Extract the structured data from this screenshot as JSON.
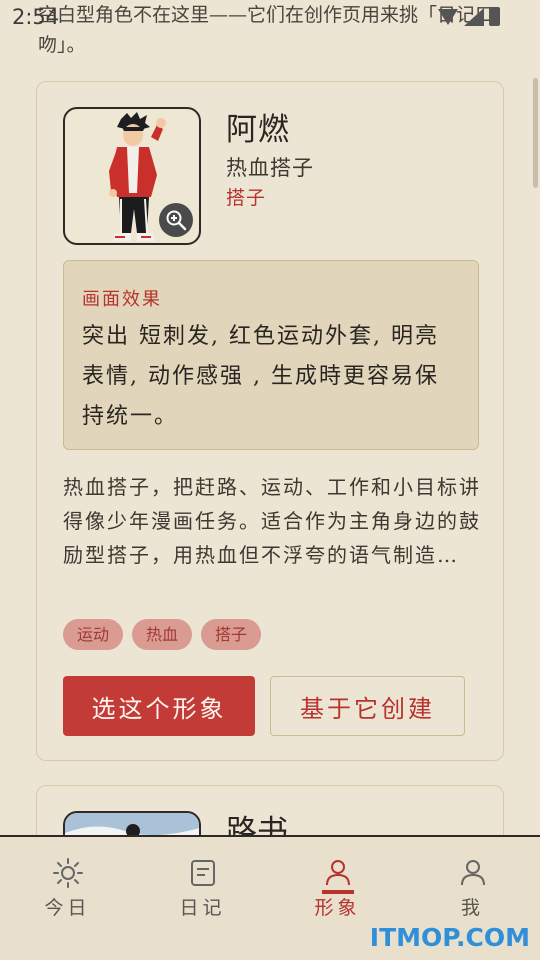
{
  "status_bar": {
    "time": "2:54"
  },
  "intro": {
    "text": "空白型角色不在这里——它们在创作页用来挑「日记口吻」。"
  },
  "cards": [
    {
      "name": "阿燃",
      "role": "热血搭子",
      "tag": "搭子",
      "effect_title": "画面效果",
      "effect_text": "突出 短刺发, 红色运动外套, 明亮表情, 动作感强 , 生成時更容易保持统一。",
      "description": "热血搭子，把赶路、运动、工作和小目标讲得像少年漫画任务。适合作为主角身边的鼓励型搭子，用热血但不浮夸的语气制造…",
      "chips": [
        "运动",
        "热血",
        "搭子"
      ],
      "primary_button": "选这个形象",
      "secondary_button": "基于它创建"
    },
    {
      "name": "路书"
    }
  ],
  "bottom_nav": [
    {
      "label": "今日",
      "icon": "sun-icon"
    },
    {
      "label": "日记",
      "icon": "diary-icon"
    },
    {
      "label": "形象",
      "icon": "person-icon",
      "active": true
    },
    {
      "label": "我",
      "icon": "user-icon"
    }
  ],
  "watermark": "ITMOP.COM",
  "colors": {
    "accent": "#c23b37",
    "background": "#ece5d4",
    "chip": "#d99b92"
  }
}
